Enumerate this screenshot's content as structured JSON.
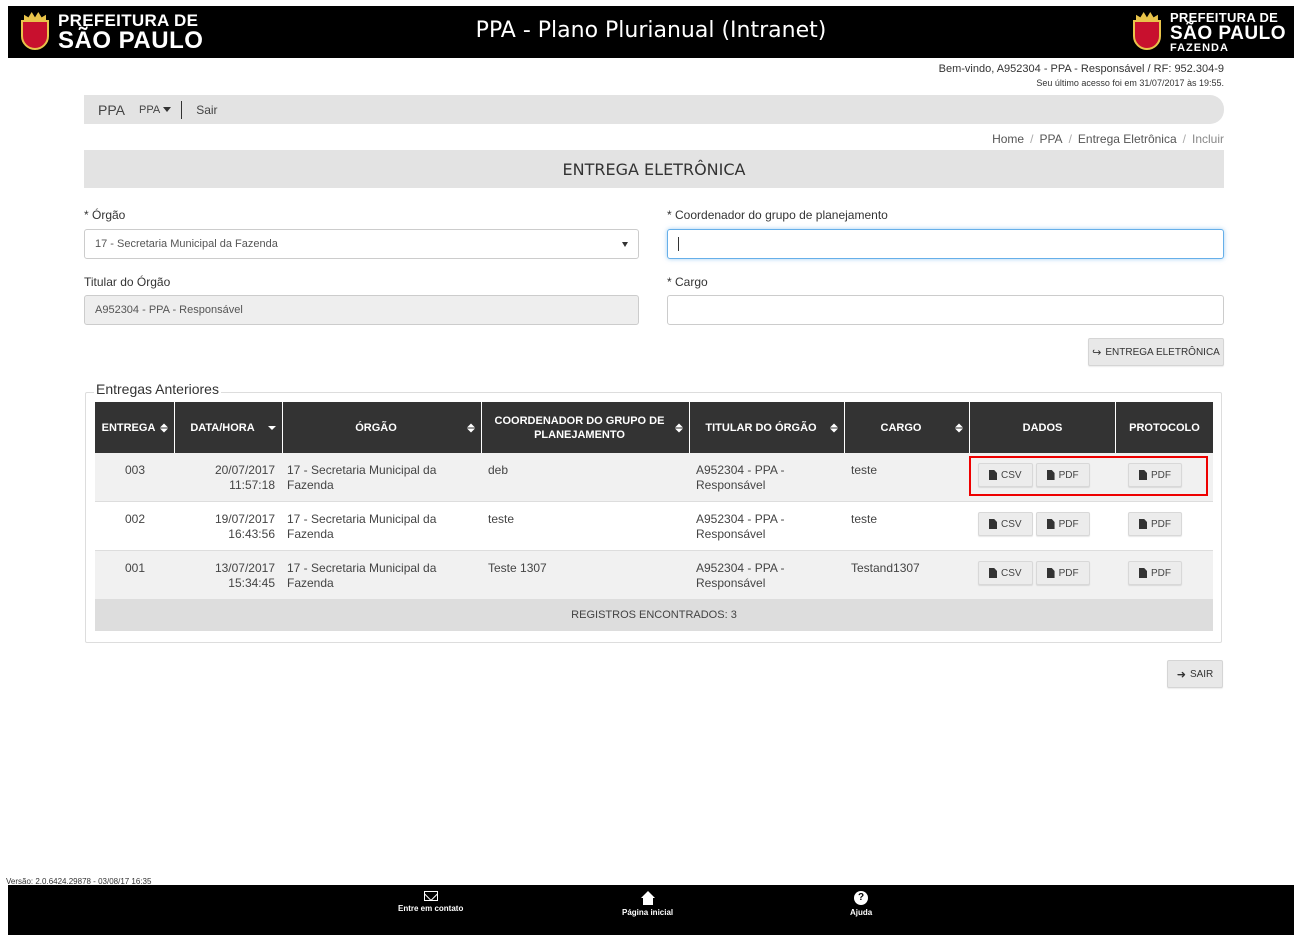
{
  "header": {
    "logo_left_line1": "PREFEITURA DE",
    "logo_left_line2": "SÃO PAULO",
    "title": "PPA - Plano Plurianual (Intranet)",
    "logo_right_line1": "PREFEITURA DE",
    "logo_right_line2": "SÃO PAULO",
    "logo_right_line3": "FAZENDA"
  },
  "welcome": {
    "line1": "Bem-vindo, A952304 - PPA - Responsável / RF: 952.304-9",
    "line2": "Seu último acesso foi em 31/07/2017 às 19:55."
  },
  "nav": {
    "brand": "PPA",
    "dropdown": "PPA",
    "exit": "Sair"
  },
  "breadcrumb": [
    "Home",
    "PPA",
    "Entrega Eletrônica",
    "Incluir"
  ],
  "page_title": "ENTREGA ELETRÔNICA",
  "form": {
    "orgao_label": "* Órgão",
    "orgao_value": "17 - Secretaria Municipal da Fazenda",
    "titular_label": "Titular do Órgão",
    "titular_value": "A952304 - PPA - Responsável",
    "coordenador_label": "* Coordenador do grupo de planejamento",
    "coordenador_value": "",
    "cargo_label": "* Cargo",
    "cargo_value": "",
    "submit_label": "ENTREGA ELETRÔNICA"
  },
  "entregas": {
    "legend": "Entregas Anteriores",
    "columns": [
      "ENTREGA",
      "DATA/HORA",
      "ÓRGÃO",
      "COORDENADOR DO GRUPO DE PLANEJAMENTO",
      "TITULAR DO ÓRGÃO",
      "CARGO",
      "DADOS",
      "PROTOCOLO"
    ],
    "rows": [
      {
        "entrega": "003",
        "date": "20/07/2017",
        "time": "11:57:18",
        "orgao": "17 - Secretaria Municipal da Fazenda",
        "coordenador": "deb",
        "titular": "A952304 - PPA - Responsável",
        "cargo": "teste"
      },
      {
        "entrega": "002",
        "date": "19/07/2017",
        "time": "16:43:56",
        "orgao": "17 - Secretaria Municipal da Fazenda",
        "coordenador": "teste",
        "titular": "A952304 - PPA - Responsável",
        "cargo": "teste"
      },
      {
        "entrega": "001",
        "date": "13/07/2017",
        "time": "15:34:45",
        "orgao": "17 - Secretaria Municipal da Fazenda",
        "coordenador": "Teste 1307",
        "titular": "A952304 - PPA - Responsável",
        "cargo": "Testand1307"
      }
    ],
    "csv_label": "CSV",
    "pdf_label": "PDF",
    "footer": "REGISTROS ENCONTRADOS: 3"
  },
  "exit_button": "SAIR",
  "version": "Versão: 2.0.6424.29878 - 03/08/17 16:35",
  "footer": {
    "contact": "Entre em contato",
    "home": "Página inicial",
    "help": "Ajuda"
  },
  "icons": {
    "file": "file-icon",
    "share": "share-arrow-icon",
    "arrow": "arrow-right-icon",
    "envelope": "envelope-icon",
    "home": "home-icon",
    "help": "help-icon"
  },
  "colors": {
    "header_bg": "#000000",
    "table_head_bg": "#333333",
    "highlight": "#ee0000",
    "focus": "#66afe9"
  }
}
